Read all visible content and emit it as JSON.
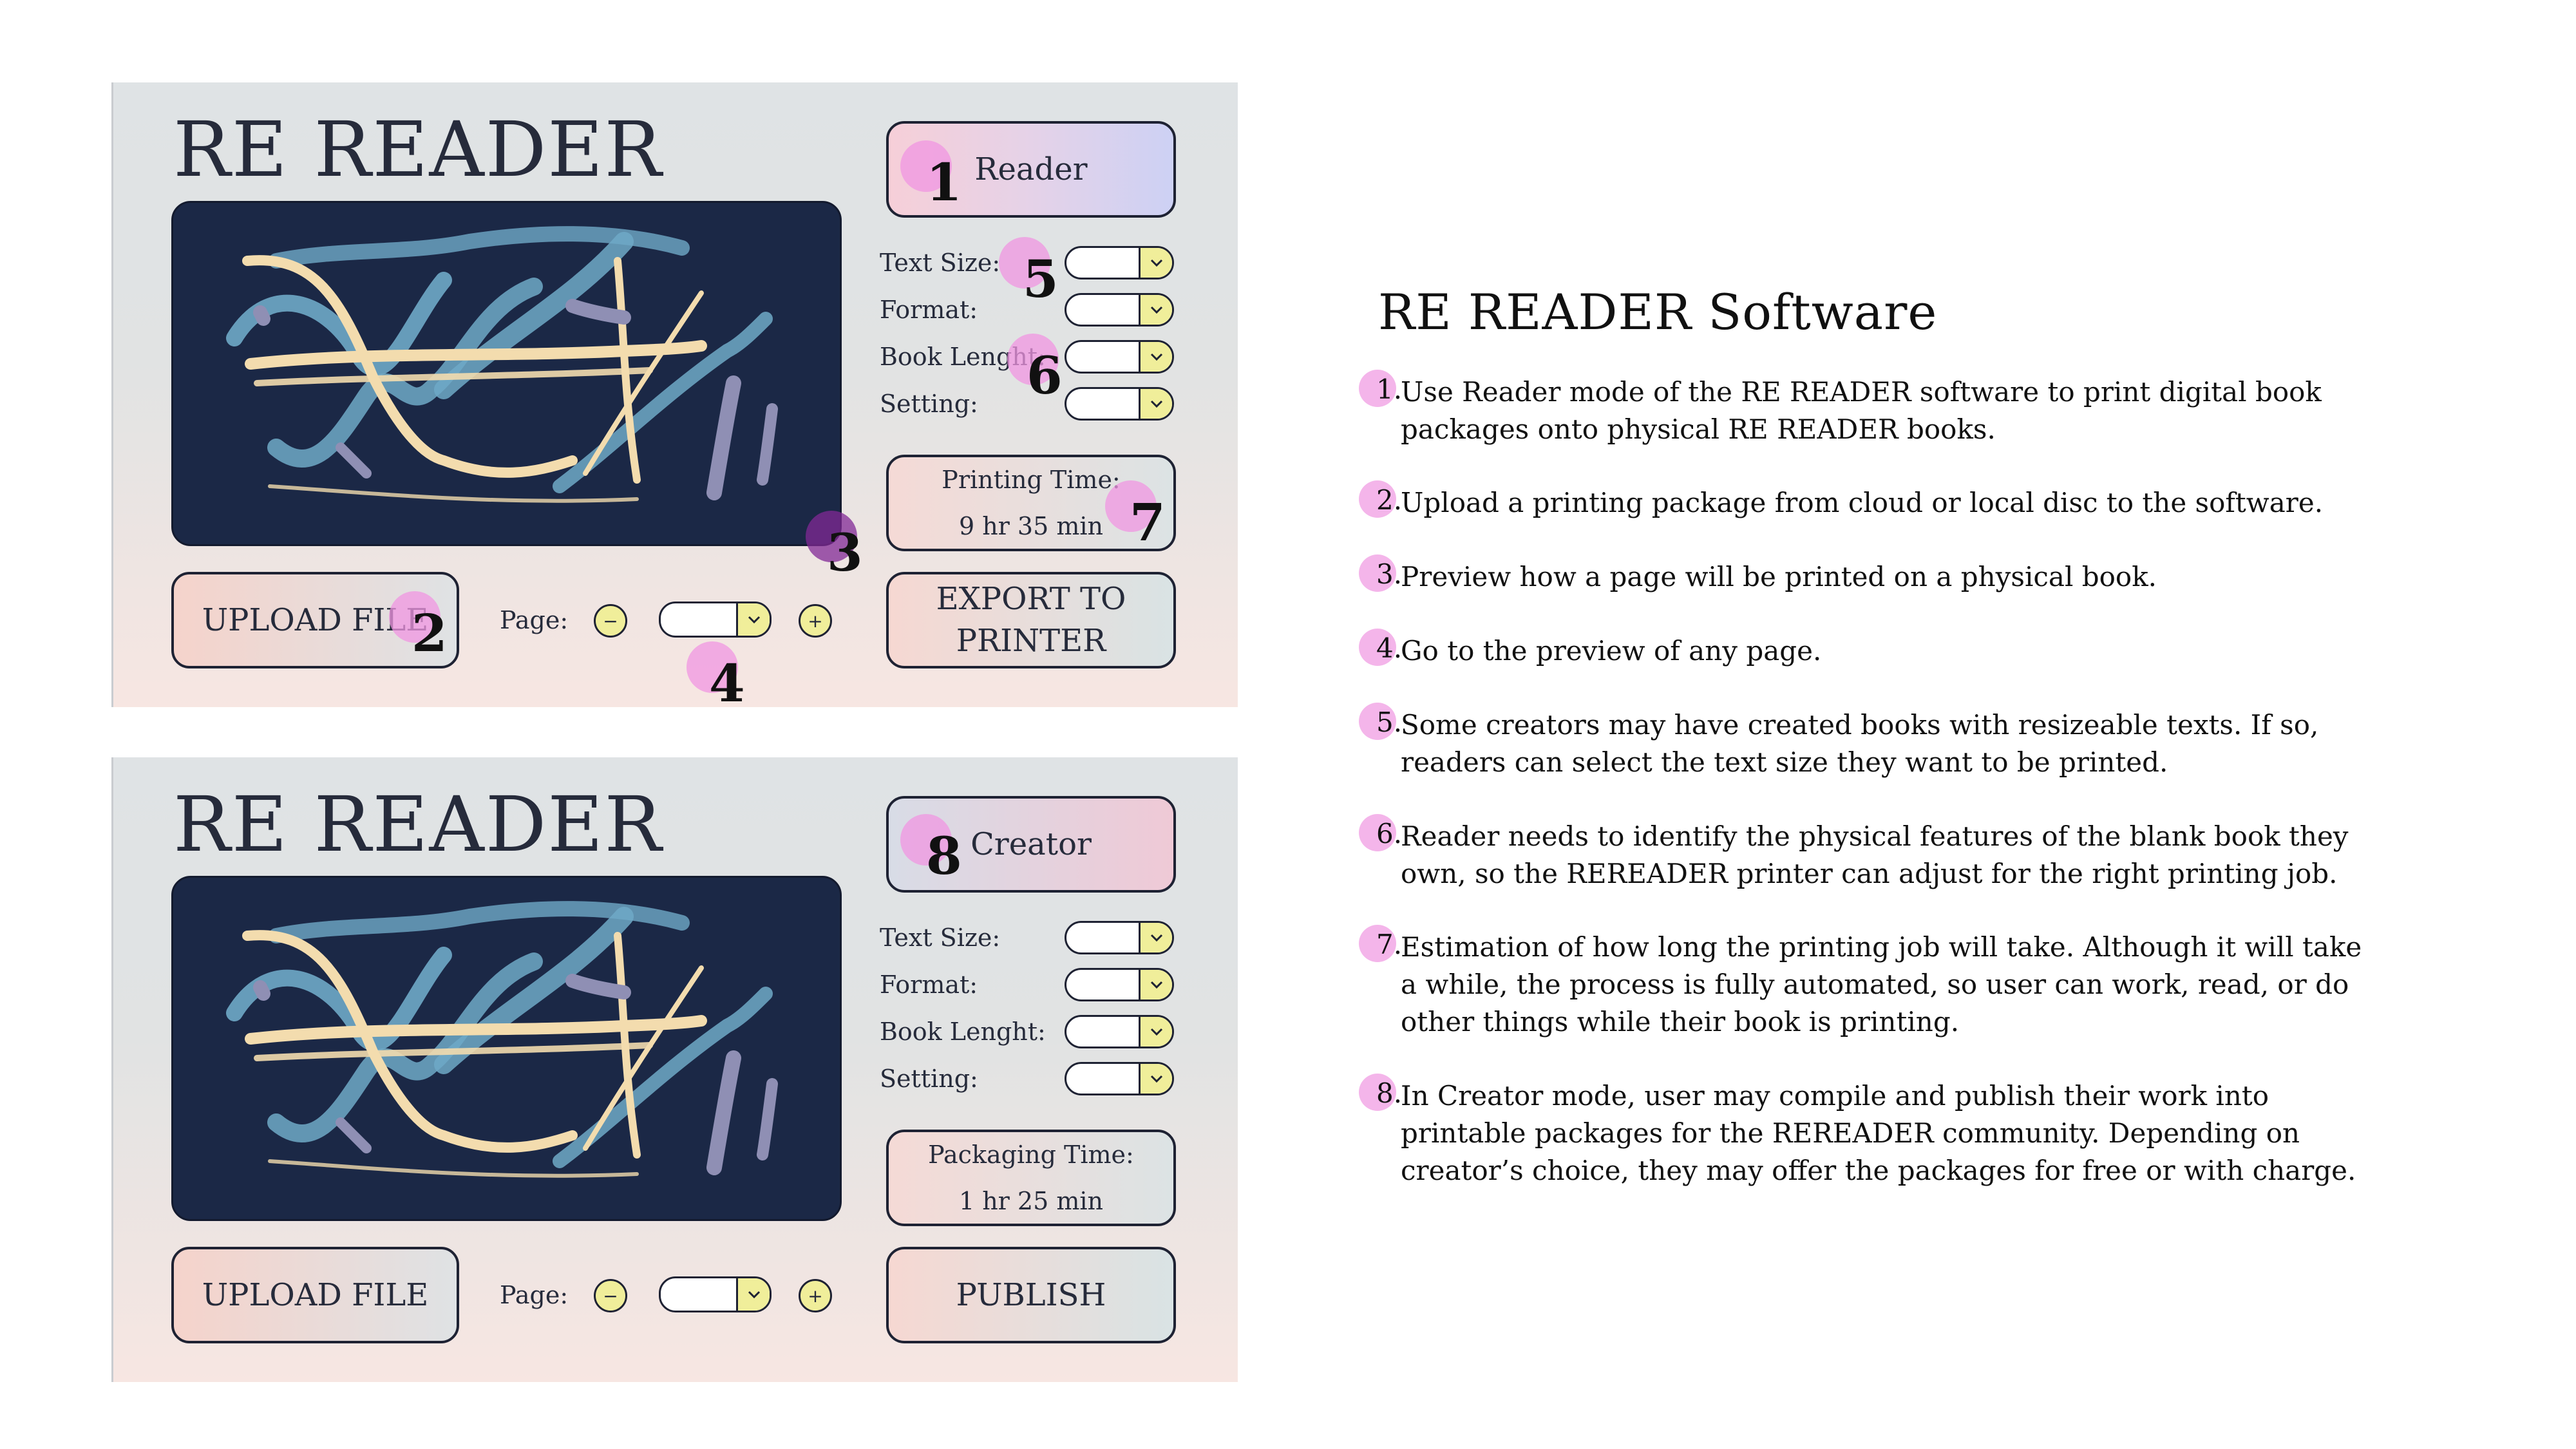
{
  "colors": {
    "panel_bg": "#dfe3e5",
    "preview_bg": "#1b2846",
    "accent_yellow": "#f0ee9a",
    "marker_pink": "#f096e1",
    "marker_purple": "#822896",
    "stroke_blue": "#6fa9c7",
    "stroke_cream": "#f3dcae",
    "stroke_lavender": "#8f8fb4"
  },
  "panels": {
    "reader": {
      "app_title": "RE READER",
      "mode_label": "Reader",
      "settings": [
        {
          "label": "Text Size:",
          "value": ""
        },
        {
          "label": "Format:",
          "value": ""
        },
        {
          "label": "Book Lenght:",
          "value": ""
        },
        {
          "label": "Setting:",
          "value": ""
        }
      ],
      "time_label": "Printing Time:",
      "time_value": "9 hr 35 min",
      "upload_label": "UPLOAD FILE",
      "page_label": "Page:",
      "minus_label": "−",
      "plus_label": "+",
      "page_value": "",
      "action_line1": "EXPORT TO",
      "action_line2": "PRINTER",
      "chevron_icon": "chevron-down-icon"
    },
    "creator": {
      "app_title": "RE READER",
      "mode_label": "Creator",
      "settings": [
        {
          "label": "Text Size:",
          "value": ""
        },
        {
          "label": "Format:",
          "value": ""
        },
        {
          "label": "Book Lenght:",
          "value": ""
        },
        {
          "label": "Setting:",
          "value": ""
        }
      ],
      "time_label": "Packaging Time:",
      "time_value": "1 hr 25 min",
      "upload_label": "UPLOAD FILE",
      "page_label": "Page:",
      "minus_label": "−",
      "plus_label": "+",
      "page_value": "",
      "action_label": "PUBLISH",
      "chevron_icon": "chevron-down-icon"
    }
  },
  "markers": [
    "1",
    "2",
    "3",
    "4",
    "5",
    "6",
    "7",
    "8"
  ],
  "docs": {
    "title": "RE READER Software",
    "items": [
      {
        "num": "1.",
        "text": "Use Reader mode of the RE READER software to print digital book packages onto physical RE READER books."
      },
      {
        "num": "2.",
        "text": "Upload a printing package from cloud or local disc to the software."
      },
      {
        "num": "3.",
        "text": "Preview how a page will be printed on a physical book."
      },
      {
        "num": "4.",
        "text": "Go to the preview of any page."
      },
      {
        "num": "5.",
        "text": "Some creators may have created books with resizeable texts. If so, readers can select the text size they want to be printed."
      },
      {
        "num": "6.",
        "text": "Reader needs to identify the physical features of the blank book they own, so the REREADER printer can adjust for the right printing job."
      },
      {
        "num": "7.",
        "text": "Estimation of how long the printing job will take. Although it will take a while, the process is fully automated, so user can work, read, or do other things while their book is printing."
      },
      {
        "num": "8.",
        "text": "In Creator mode, user may compile and publish their work into printable packages for the REREADER community. Depending on creator’s choice, they may offer the packages for free or with charge."
      }
    ]
  }
}
